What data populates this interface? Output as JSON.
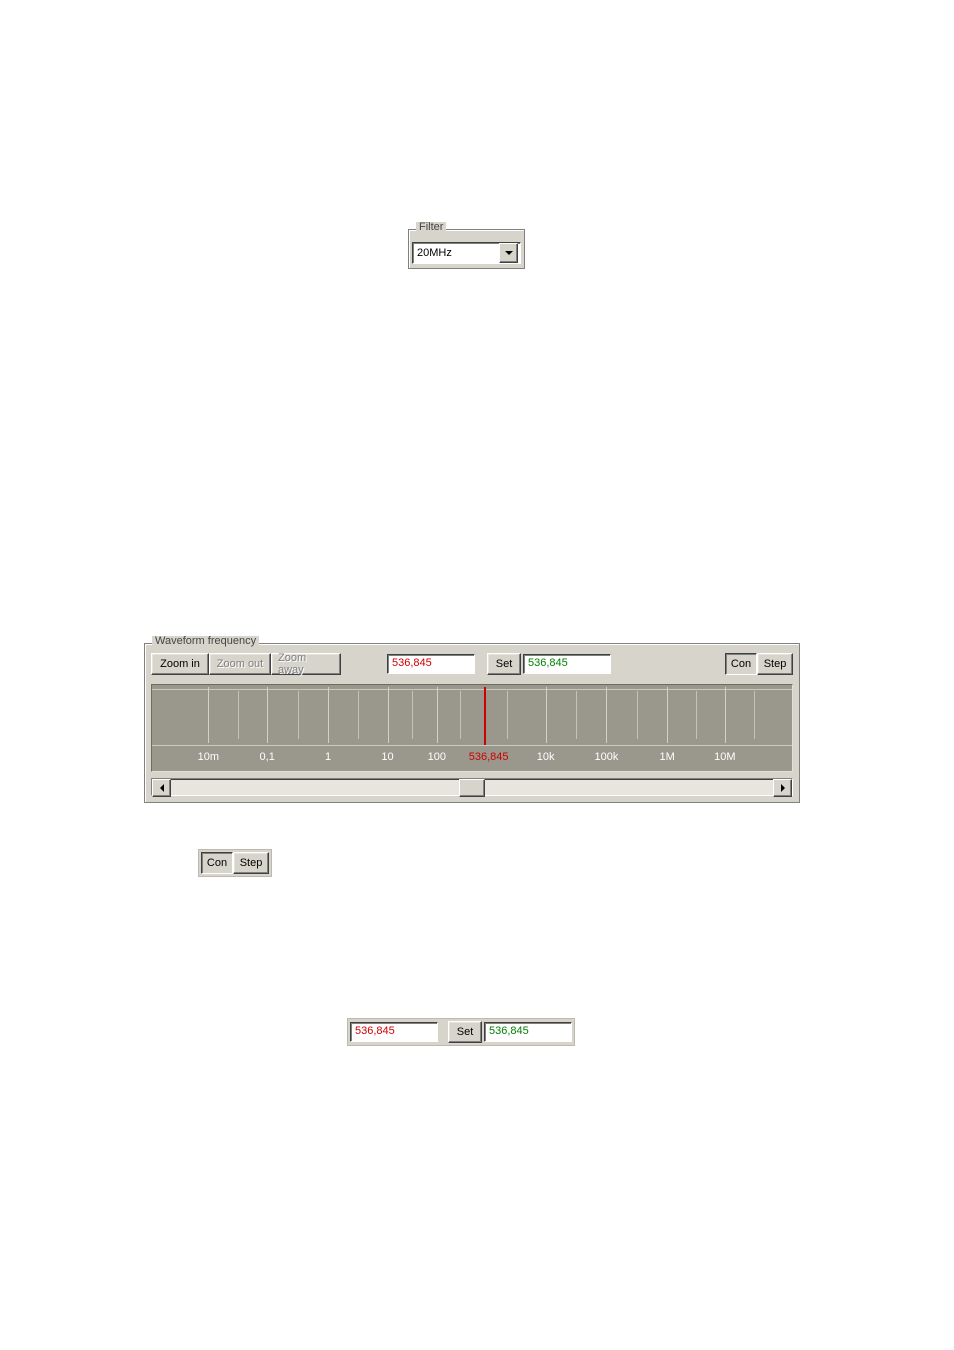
{
  "filter": {
    "group_label": "Filter",
    "selected": "20MHz"
  },
  "waveform": {
    "group_label": "Waveform frequency",
    "buttons": {
      "zoom_in": "Zoom in",
      "zoom_out": "Zoom out",
      "zoom_away": "Zoom away",
      "set": "Set",
      "con": "Con",
      "step": "Step"
    },
    "current_value": "536,845",
    "set_value": "536,845",
    "ruler": {
      "labels": [
        "10m",
        "0,1",
        "1",
        "10",
        "100",
        "536,845",
        "10k",
        "100k",
        "1M",
        "10M"
      ],
      "positions_pct": [
        8.8,
        18.0,
        27.5,
        36.8,
        44.5,
        51.8,
        61.5,
        71.0,
        80.5,
        89.5
      ],
      "cursor_pct": 51.8
    }
  },
  "con_step": {
    "con": "Con",
    "step": "Step"
  },
  "set_strip": {
    "current_value": "536,845",
    "set_label": "Set",
    "set_value": "536,845"
  }
}
